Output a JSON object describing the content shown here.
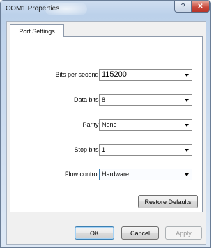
{
  "window": {
    "title": "COM1 Properties",
    "help_glyph": "?",
    "close_glyph": "✕"
  },
  "tabs": [
    {
      "label": "Port Settings",
      "selected": true
    }
  ],
  "settings": {
    "bits_per_second": {
      "label": "Bits per second:",
      "value": "115200"
    },
    "data_bits": {
      "label": "Data bits:",
      "value": "8"
    },
    "parity": {
      "label": "Parity:",
      "value": "None"
    },
    "stop_bits": {
      "label": "Stop bits:",
      "value": "1"
    },
    "flow_control": {
      "label": "Flow control:",
      "value": "Hardware"
    }
  },
  "buttons": {
    "restore_defaults": "Restore Defaults",
    "ok": "OK",
    "cancel": "Cancel",
    "apply": "Apply"
  },
  "colors": {
    "accent": "#3c7fb1",
    "close_button": "#c9483a"
  }
}
